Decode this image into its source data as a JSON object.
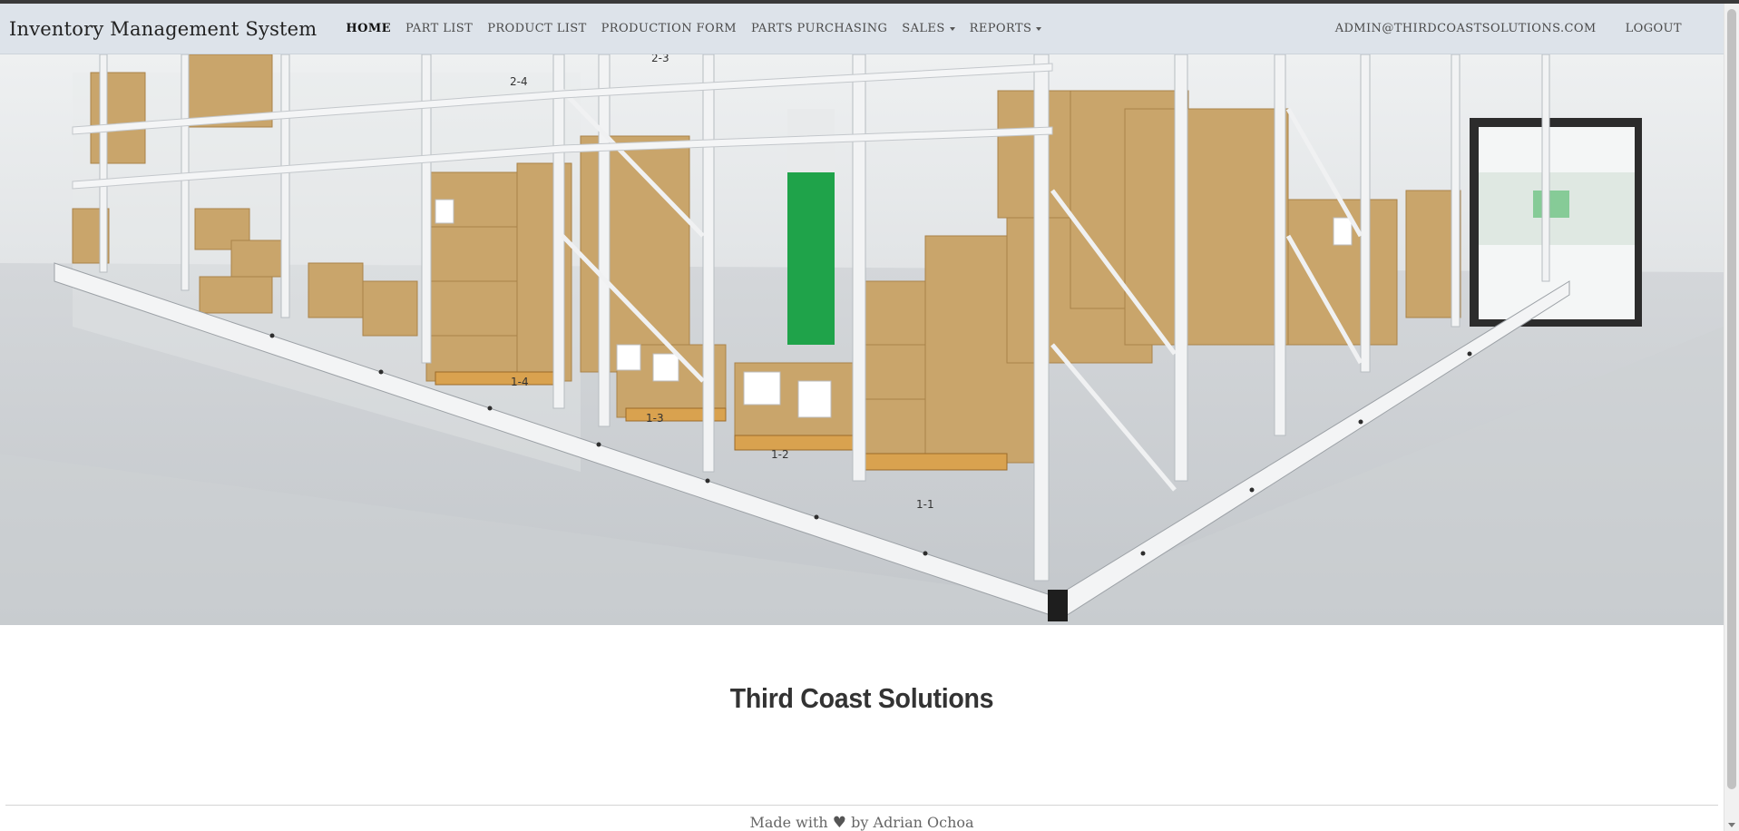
{
  "navbar": {
    "brand": "Inventory Management System",
    "links": [
      {
        "label": "HOME",
        "active": true
      },
      {
        "label": "PART LIST"
      },
      {
        "label": "PRODUCT LIST"
      },
      {
        "label": "PRODUCTION FORM"
      },
      {
        "label": "PARTS PURCHASING"
      },
      {
        "label": "SALES",
        "dropdown": true
      },
      {
        "label": "REPORTS",
        "dropdown": true
      }
    ],
    "user_email": "ADMIN@THIRDCOASTSOLUTIONS.COM",
    "logout_label": "LOGOUT"
  },
  "hero": {
    "rack_labels": [
      "1-1",
      "1-2",
      "1-3",
      "1-4",
      "2-3",
      "2-4"
    ]
  },
  "main": {
    "company_name": "Third Coast Solutions"
  },
  "footer": {
    "made_with": "Made with",
    "heart_icon": "heart-icon",
    "by_author": "by Adrian Ochoa"
  },
  "colors": {
    "navbar_bg": "#dde3ea",
    "box": "#c9a56b",
    "rack": "#f2f3f4",
    "accent_green": "#1fa34a"
  }
}
